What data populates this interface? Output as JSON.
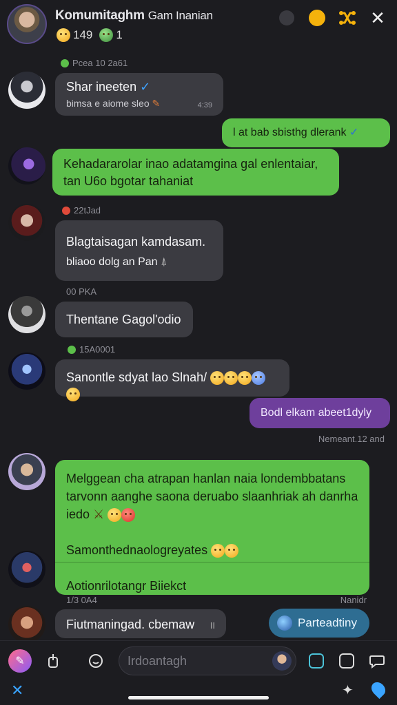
{
  "header": {
    "title_bold": "Komumitaghm",
    "title_rest": "Gam Inanian",
    "member_count": "149",
    "online_count": "1",
    "icons": [
      "avatar",
      "dark-dot-icon",
      "yellow-dot-icon",
      "shuffle-icon",
      "close-icon"
    ]
  },
  "messages": [
    {
      "stamp": "Pcea 10 2a61",
      "text": "Shar ineeten",
      "sub": "bimsa e aiome sleo",
      "meta": "4:39"
    },
    {
      "text": "l at bab sbisthg dlerank"
    },
    {
      "text": "Kehadararolar inao adatamgina gal enlentaiar, tan U6o bgotar tahaniat"
    },
    {
      "stamp": "22tJad",
      "text": "Blagtaisagan kamdasam.",
      "sub": "bliaoo dolg an Pan"
    },
    {
      "stamp": "00 PKA",
      "text": "Thentane Gagol'odio"
    },
    {
      "stamp": "15A0001",
      "text": "Sanontle sdyat lao Slnah/"
    },
    {
      "text": "Bodl elkam abeet1dyly",
      "meta": "Nemeant.12 and"
    },
    {
      "text": "Melggean cha atrapan hanlan naia londembbatans tarvonn aanghe saona deruabo slaanhriak ah danrha iedo",
      "line2": "Samonthednaologreyates",
      "line3": "Aotionrilotangr Biiekct",
      "stamp_left": "1/3 0A4",
      "stamp_right": "Nanidr"
    },
    {
      "text": "Fiutmaningad. cbemaw",
      "meta": "II"
    }
  ],
  "pill": {
    "label": "Parteadtiny"
  },
  "composer": {
    "placeholder": "Irdoantagh"
  }
}
